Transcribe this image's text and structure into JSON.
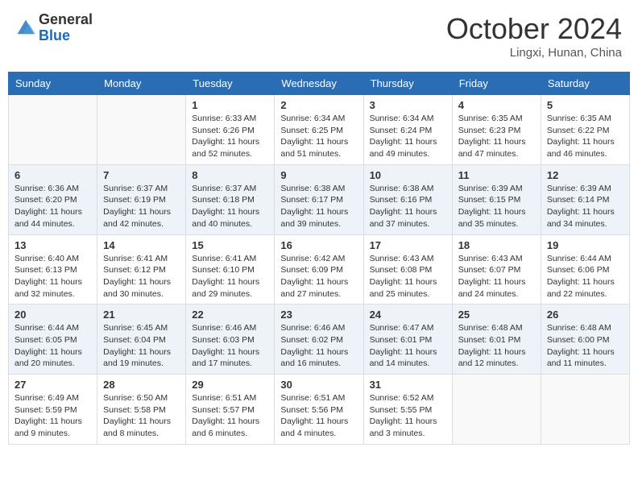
{
  "header": {
    "logo_general": "General",
    "logo_blue": "Blue",
    "month_title": "October 2024",
    "location": "Lingxi, Hunan, China"
  },
  "days_of_week": [
    "Sunday",
    "Monday",
    "Tuesday",
    "Wednesday",
    "Thursday",
    "Friday",
    "Saturday"
  ],
  "weeks": [
    [
      {
        "day": "",
        "info": ""
      },
      {
        "day": "",
        "info": ""
      },
      {
        "day": "1",
        "info": "Sunrise: 6:33 AM\nSunset: 6:26 PM\nDaylight: 11 hours and 52 minutes."
      },
      {
        "day": "2",
        "info": "Sunrise: 6:34 AM\nSunset: 6:25 PM\nDaylight: 11 hours and 51 minutes."
      },
      {
        "day": "3",
        "info": "Sunrise: 6:34 AM\nSunset: 6:24 PM\nDaylight: 11 hours and 49 minutes."
      },
      {
        "day": "4",
        "info": "Sunrise: 6:35 AM\nSunset: 6:23 PM\nDaylight: 11 hours and 47 minutes."
      },
      {
        "day": "5",
        "info": "Sunrise: 6:35 AM\nSunset: 6:22 PM\nDaylight: 11 hours and 46 minutes."
      }
    ],
    [
      {
        "day": "6",
        "info": "Sunrise: 6:36 AM\nSunset: 6:20 PM\nDaylight: 11 hours and 44 minutes."
      },
      {
        "day": "7",
        "info": "Sunrise: 6:37 AM\nSunset: 6:19 PM\nDaylight: 11 hours and 42 minutes."
      },
      {
        "day": "8",
        "info": "Sunrise: 6:37 AM\nSunset: 6:18 PM\nDaylight: 11 hours and 40 minutes."
      },
      {
        "day": "9",
        "info": "Sunrise: 6:38 AM\nSunset: 6:17 PM\nDaylight: 11 hours and 39 minutes."
      },
      {
        "day": "10",
        "info": "Sunrise: 6:38 AM\nSunset: 6:16 PM\nDaylight: 11 hours and 37 minutes."
      },
      {
        "day": "11",
        "info": "Sunrise: 6:39 AM\nSunset: 6:15 PM\nDaylight: 11 hours and 35 minutes."
      },
      {
        "day": "12",
        "info": "Sunrise: 6:39 AM\nSunset: 6:14 PM\nDaylight: 11 hours and 34 minutes."
      }
    ],
    [
      {
        "day": "13",
        "info": "Sunrise: 6:40 AM\nSunset: 6:13 PM\nDaylight: 11 hours and 32 minutes."
      },
      {
        "day": "14",
        "info": "Sunrise: 6:41 AM\nSunset: 6:12 PM\nDaylight: 11 hours and 30 minutes."
      },
      {
        "day": "15",
        "info": "Sunrise: 6:41 AM\nSunset: 6:10 PM\nDaylight: 11 hours and 29 minutes."
      },
      {
        "day": "16",
        "info": "Sunrise: 6:42 AM\nSunset: 6:09 PM\nDaylight: 11 hours and 27 minutes."
      },
      {
        "day": "17",
        "info": "Sunrise: 6:43 AM\nSunset: 6:08 PM\nDaylight: 11 hours and 25 minutes."
      },
      {
        "day": "18",
        "info": "Sunrise: 6:43 AM\nSunset: 6:07 PM\nDaylight: 11 hours and 24 minutes."
      },
      {
        "day": "19",
        "info": "Sunrise: 6:44 AM\nSunset: 6:06 PM\nDaylight: 11 hours and 22 minutes."
      }
    ],
    [
      {
        "day": "20",
        "info": "Sunrise: 6:44 AM\nSunset: 6:05 PM\nDaylight: 11 hours and 20 minutes."
      },
      {
        "day": "21",
        "info": "Sunrise: 6:45 AM\nSunset: 6:04 PM\nDaylight: 11 hours and 19 minutes."
      },
      {
        "day": "22",
        "info": "Sunrise: 6:46 AM\nSunset: 6:03 PM\nDaylight: 11 hours and 17 minutes."
      },
      {
        "day": "23",
        "info": "Sunrise: 6:46 AM\nSunset: 6:02 PM\nDaylight: 11 hours and 16 minutes."
      },
      {
        "day": "24",
        "info": "Sunrise: 6:47 AM\nSunset: 6:01 PM\nDaylight: 11 hours and 14 minutes."
      },
      {
        "day": "25",
        "info": "Sunrise: 6:48 AM\nSunset: 6:01 PM\nDaylight: 11 hours and 12 minutes."
      },
      {
        "day": "26",
        "info": "Sunrise: 6:48 AM\nSunset: 6:00 PM\nDaylight: 11 hours and 11 minutes."
      }
    ],
    [
      {
        "day": "27",
        "info": "Sunrise: 6:49 AM\nSunset: 5:59 PM\nDaylight: 11 hours and 9 minutes."
      },
      {
        "day": "28",
        "info": "Sunrise: 6:50 AM\nSunset: 5:58 PM\nDaylight: 11 hours and 8 minutes."
      },
      {
        "day": "29",
        "info": "Sunrise: 6:51 AM\nSunset: 5:57 PM\nDaylight: 11 hours and 6 minutes."
      },
      {
        "day": "30",
        "info": "Sunrise: 6:51 AM\nSunset: 5:56 PM\nDaylight: 11 hours and 4 minutes."
      },
      {
        "day": "31",
        "info": "Sunrise: 6:52 AM\nSunset: 5:55 PM\nDaylight: 11 hours and 3 minutes."
      },
      {
        "day": "",
        "info": ""
      },
      {
        "day": "",
        "info": ""
      }
    ]
  ]
}
